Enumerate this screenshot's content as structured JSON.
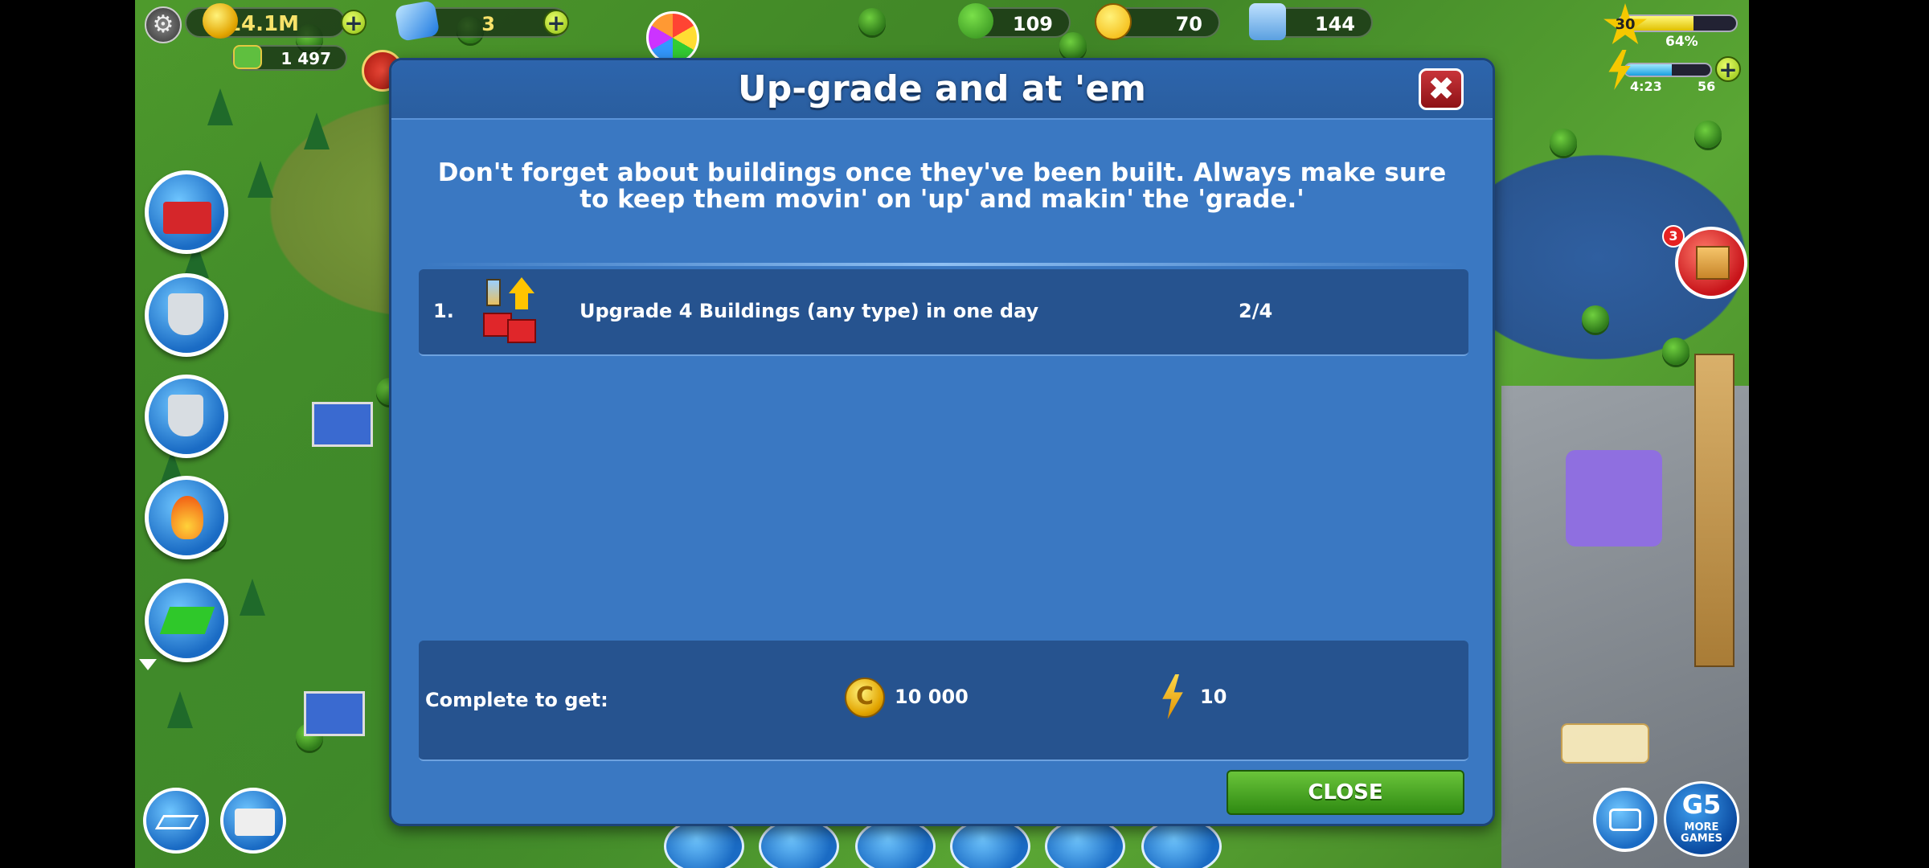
{
  "hud": {
    "coins": "14.1M",
    "cash": "1 497",
    "gems": "3",
    "trees": "109",
    "happiness": "70",
    "population": "144",
    "level": "30",
    "xp_percent": "64%",
    "xp_fraction": 0.64,
    "energy_timer": "4:23",
    "energy_count": "56",
    "energy_fraction": 0.55,
    "plus_symbol": "+",
    "notification_badge": "3"
  },
  "dialog": {
    "title": "Up-grade and at 'em",
    "description": "Don't forget about buildings once they've been built. Always make sure to keep them movin' on 'up' and makin' the 'grade.'",
    "tasks": [
      {
        "number": "1.",
        "label": "Upgrade 4 Buildings (any type) in one day",
        "progress": "2/4",
        "icon": "upgrade-houses-icon"
      }
    ],
    "reward": {
      "label": "Complete to get:",
      "coin_symbol": "C",
      "coins": "10 000",
      "energy": "10"
    },
    "close_label": "CLOSE"
  },
  "branding": {
    "more_games_top": "G5",
    "more_games_bottom": "MORE GAMES"
  },
  "colors": {
    "dialog_bg": "#3a78c2",
    "row_bg": "#26538f",
    "close_button": "#2f8a12",
    "close_x": "#c8343a"
  }
}
